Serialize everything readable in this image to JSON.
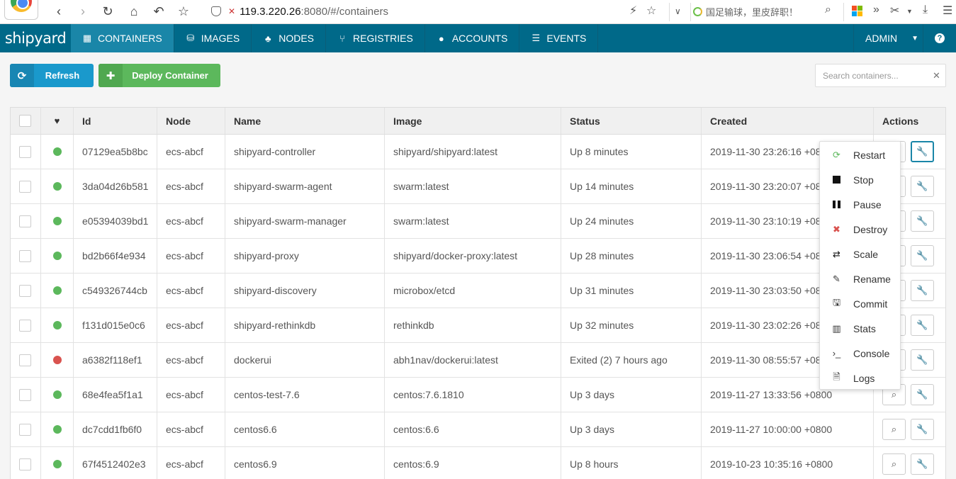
{
  "browser": {
    "url_host": "119.3.220.26",
    "url_rest": ":8080/#/containers",
    "search_text": "国足输球，里皮辞职！"
  },
  "nav": {
    "brand": "shipyard",
    "items": [
      {
        "label": "CONTAINERS",
        "icon": "table-icon",
        "glyph": "▦",
        "active": true
      },
      {
        "label": "IMAGES",
        "icon": "drive-icon",
        "glyph": "⛁",
        "active": false
      },
      {
        "label": "NODES",
        "icon": "sitemap-icon",
        "glyph": "♣",
        "active": false
      },
      {
        "label": "REGISTRIES",
        "icon": "branch-icon",
        "glyph": "⑂",
        "active": false
      },
      {
        "label": "ACCOUNTS",
        "icon": "user-icon",
        "glyph": "●",
        "active": false
      },
      {
        "label": "EVENTS",
        "icon": "list-icon",
        "glyph": "☰",
        "active": false
      }
    ],
    "user": "ADMIN",
    "help": "?"
  },
  "toolbar": {
    "refresh_label": "Refresh",
    "deploy_label": "Deploy Container",
    "search_placeholder": "Search containers..."
  },
  "table": {
    "headers": [
      "",
      "♥",
      "Id",
      "Node",
      "Name",
      "Image",
      "Status",
      "Created",
      "Actions"
    ],
    "colors": {
      "running": "#5cb85c",
      "stopped": "#d9534f"
    },
    "rows": [
      {
        "state": "running",
        "id": "07129ea5b8bc",
        "node": "ecs-abcf",
        "name": "shipyard-controller",
        "image": "shipyard/shipyard:latest",
        "status": "Up 8 minutes",
        "created": "2019-11-30 23:26:16 +0800"
      },
      {
        "state": "running",
        "id": "3da04d26b581",
        "node": "ecs-abcf",
        "name": "shipyard-swarm-agent",
        "image": "swarm:latest",
        "status": "Up 14 minutes",
        "created": "2019-11-30 23:20:07 +0800"
      },
      {
        "state": "running",
        "id": "e05394039bd1",
        "node": "ecs-abcf",
        "name": "shipyard-swarm-manager",
        "image": "swarm:latest",
        "status": "Up 24 minutes",
        "created": "2019-11-30 23:10:19 +0800"
      },
      {
        "state": "running",
        "id": "bd2b66f4e934",
        "node": "ecs-abcf",
        "name": "shipyard-proxy",
        "image": "shipyard/docker-proxy:latest",
        "status": "Up 28 minutes",
        "created": "2019-11-30 23:06:54 +0800"
      },
      {
        "state": "running",
        "id": "c549326744cb",
        "node": "ecs-abcf",
        "name": "shipyard-discovery",
        "image": "microbox/etcd",
        "status": "Up 31 minutes",
        "created": "2019-11-30 23:03:50 +0800"
      },
      {
        "state": "running",
        "id": "f131d015e0c6",
        "node": "ecs-abcf",
        "name": "shipyard-rethinkdb",
        "image": "rethinkdb",
        "status": "Up 32 minutes",
        "created": "2019-11-30 23:02:26 +0800"
      },
      {
        "state": "stopped",
        "id": "a6382f118ef1",
        "node": "ecs-abcf",
        "name": "dockerui",
        "image": "abh1nav/dockerui:latest",
        "status": "Exited (2) 7 hours ago",
        "created": "2019-11-30 08:55:57 +0800"
      },
      {
        "state": "running",
        "id": "68e4fea5f1a1",
        "node": "ecs-abcf",
        "name": "centos-test-7.6",
        "image": "centos:7.6.1810",
        "status": "Up 3 days",
        "created": "2019-11-27 13:33:56 +0800"
      },
      {
        "state": "running",
        "id": "dc7cdd1fb6f0",
        "node": "ecs-abcf",
        "name": "centos6.6",
        "image": "centos:6.6",
        "status": "Up 3 days",
        "created": "2019-11-27 10:00:00 +0800"
      },
      {
        "state": "running",
        "id": "67f4512402e3",
        "node": "ecs-abcf",
        "name": "centos6.9",
        "image": "centos:6.9",
        "status": "Up 8 hours",
        "created": "2019-10-23 10:35:16 +0800"
      }
    ]
  },
  "menu": {
    "items": [
      {
        "label": "Restart",
        "icon": "refresh-icon",
        "color": "#5cb85c"
      },
      {
        "label": "Stop",
        "icon": "stop-icon",
        "color": "#111111"
      },
      {
        "label": "Pause",
        "icon": "pause-icon",
        "color": "#111111"
      },
      {
        "label": "Destroy",
        "icon": "remove-icon",
        "color": "#d9534f"
      },
      {
        "label": "Scale",
        "icon": "exchange-icon",
        "color": "#111111"
      },
      {
        "label": "Rename",
        "icon": "edit-icon",
        "color": "#333333"
      },
      {
        "label": "Commit",
        "icon": "save-icon",
        "color": "#333333"
      },
      {
        "label": "Stats",
        "icon": "bar-chart-icon",
        "color": "#333333"
      },
      {
        "label": "Console",
        "icon": "terminal-icon",
        "color": "#333333"
      },
      {
        "label": "Logs",
        "icon": "file-icon",
        "color": "#333333"
      }
    ]
  }
}
